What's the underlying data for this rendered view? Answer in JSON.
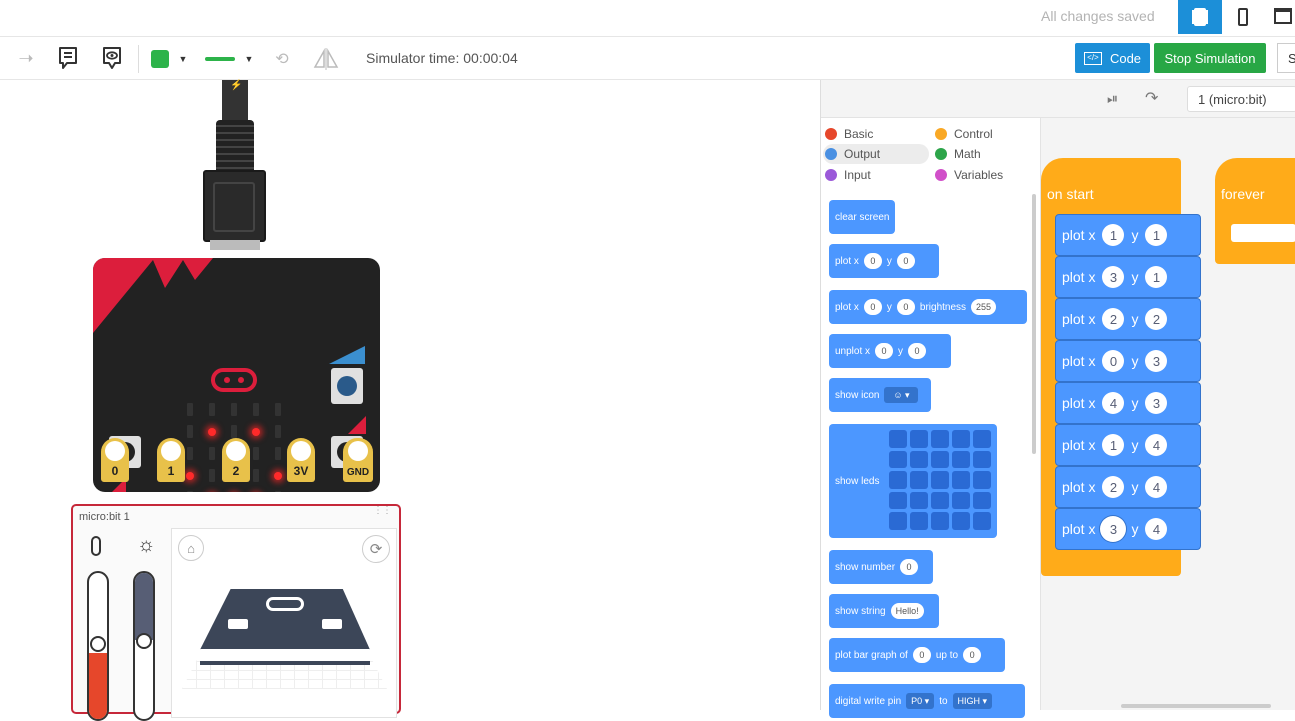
{
  "topbar": {
    "save_status": "All changes saved"
  },
  "toolbar": {
    "sim_time": "Simulator time: 00:00:04",
    "code_label": "Code",
    "stop_label": "Stop Simulation",
    "cut_label": "S",
    "device_select": "1 (micro:bit)"
  },
  "panel": {
    "title": "micro:bit 1"
  },
  "pins": [
    "0",
    "1",
    "2",
    "3V",
    "GND"
  ],
  "categories": [
    {
      "label": "Basic",
      "color": "#e6472b"
    },
    {
      "label": "Control",
      "color": "#f9a825"
    },
    {
      "label": "Output",
      "color": "#4a90e2"
    },
    {
      "label": "Math",
      "color": "#2da54a"
    },
    {
      "label": "Input",
      "color": "#9b59d9"
    },
    {
      "label": "Variables",
      "color": "#d150c9"
    }
  ],
  "palette": {
    "clear_screen": "clear screen",
    "plot_x": "plot x",
    "y": "y",
    "brightness": "brightness",
    "unplot_x": "unplot x",
    "show_icon": "show icon",
    "show_leds": "show leds",
    "show_number": "show number",
    "show_string": "show string",
    "hello": "Hello!",
    "plot_bar": "plot bar graph of",
    "up_to": "up to",
    "digital_write": "digital write pin",
    "p0": "P0",
    "to": "to",
    "high": "HIGH",
    "v0": "0",
    "v255": "255"
  },
  "workspace": {
    "on_start": "on start",
    "forever": "forever",
    "plot_x": "plot x",
    "y": "y",
    "plots": [
      [
        "1",
        "1"
      ],
      [
        "3",
        "1"
      ],
      [
        "2",
        "2"
      ],
      [
        "0",
        "3"
      ],
      [
        "4",
        "3"
      ],
      [
        "1",
        "4"
      ],
      [
        "2",
        "4"
      ],
      [
        "3",
        "4"
      ]
    ]
  },
  "colors": {
    "code_btn": "#1c8fd8",
    "stop_btn": "#28a745",
    "output_blue": "#4c97ff",
    "event_orange": "#ffab19",
    "board_red": "#dc1e3c",
    "board_black": "#222",
    "panel_border": "#c6283a"
  }
}
